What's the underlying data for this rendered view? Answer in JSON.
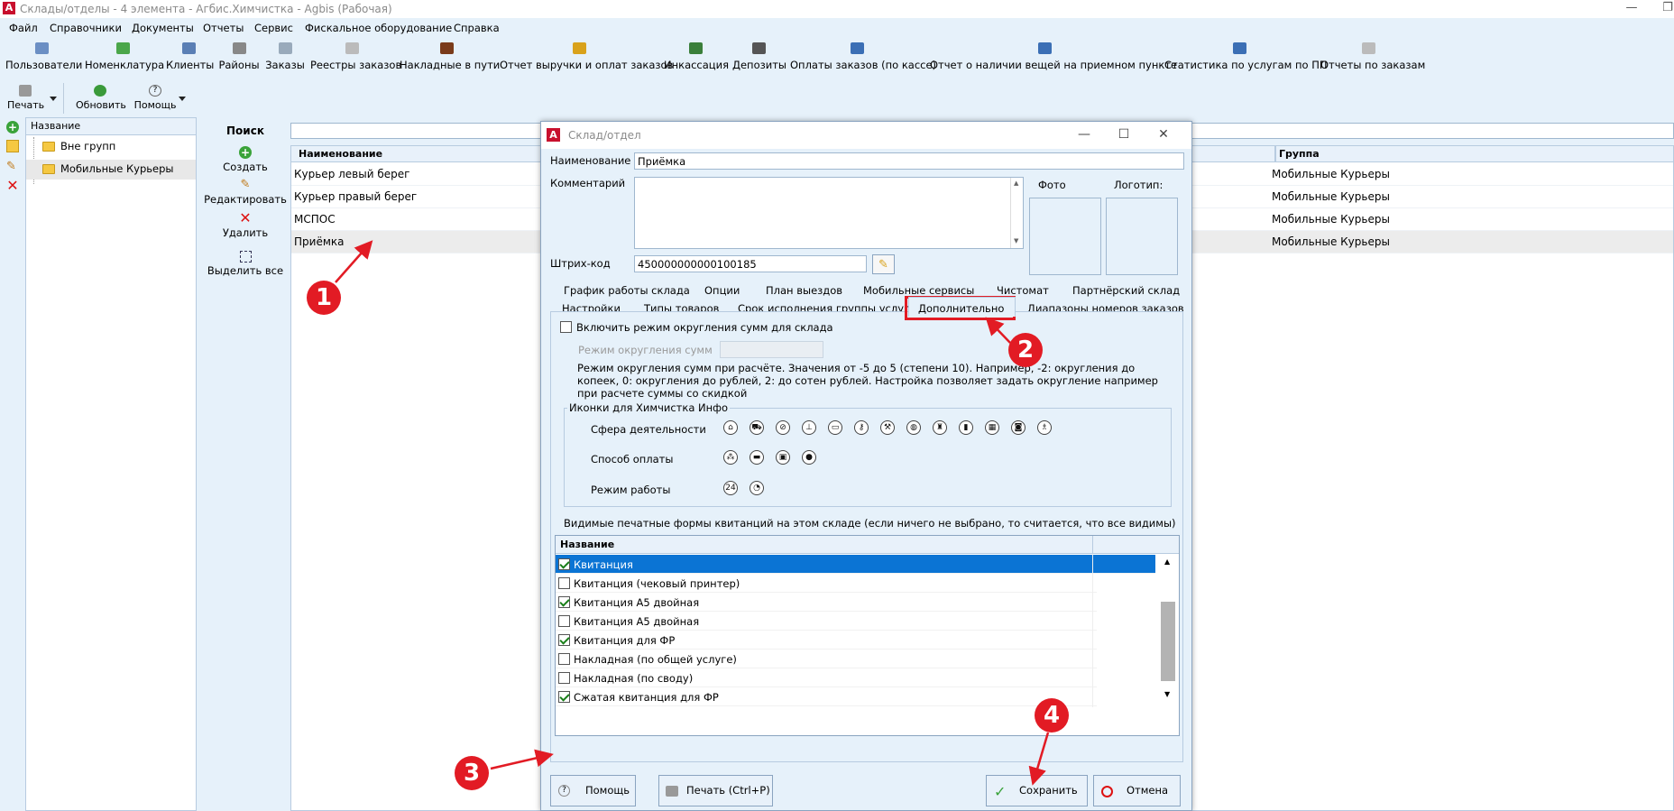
{
  "window": {
    "title": "Склады/отделы - 4 элемента - Агбис.Химчистка - Agbis (Рабочая)",
    "app_logo": "A"
  },
  "menu": [
    "Файл",
    "Справочники",
    "Документы",
    "Отчеты",
    "Сервис",
    "Фискальное оборудование",
    "Справка"
  ],
  "toolbar": [
    {
      "label": "Пользователи",
      "icon": "users-icon"
    },
    {
      "label": "Номенклатура",
      "icon": "nomenclature-icon"
    },
    {
      "label": "Клиенты",
      "icon": "clients-icon"
    },
    {
      "label": "Районы",
      "icon": "districts-icon"
    },
    {
      "label": "Заказы",
      "icon": "orders-icon"
    },
    {
      "label": "Реестры заказов",
      "icon": "registry-icon"
    },
    {
      "label": "Накладные в пути",
      "icon": "truck-icon"
    },
    {
      "label": "Отчет выручки и оплат заказов",
      "icon": "report-icon"
    },
    {
      "label": "Инкассация",
      "icon": "cash-icon"
    },
    {
      "label": "Депозиты",
      "icon": "deposit-icon"
    },
    {
      "label": "Оплаты заказов (по кассе)",
      "icon": "payment-icon"
    },
    {
      "label": "Отчет о наличии вещей на приемном пункте",
      "icon": "items-report-icon"
    },
    {
      "label": "Статистика по услугам по ПП",
      "icon": "stats-icon"
    },
    {
      "label": "Отчеты по заказам",
      "icon": "orders-report-icon"
    }
  ],
  "toolbar2": {
    "print": "Печать",
    "refresh": "Обновить",
    "help": "Помощь"
  },
  "tree": {
    "header": "Название",
    "items": [
      "Вне групп",
      "Мобильные Курьеры"
    ]
  },
  "actions": {
    "search": "Поиск",
    "create": "Создать",
    "edit": "Редактировать",
    "delete": "Удалить",
    "select_all": "Выделить все"
  },
  "grid": {
    "col_name": "Наименование",
    "col_group": "Группа",
    "rows": [
      {
        "name": "Курьер левый берег",
        "group": "Мобильные Курьеры"
      },
      {
        "name": "Курьер правый берег",
        "group": "Мобильные Курьеры"
      },
      {
        "name": "МСПОС",
        "group": "Мобильные Курьеры"
      },
      {
        "name": "Приёмка",
        "group": "Мобильные Курьеры"
      }
    ]
  },
  "dialog": {
    "title": "Склад/отдел",
    "name_label": "Наименование",
    "name_value": "Приёмка",
    "comment_label": "Комментарий",
    "barcode_label": "Штрих-код",
    "barcode_value": "450000000000100185",
    "photo_label": "Фото",
    "logo_label": "Логотип:",
    "tabs_row1": [
      "График работы склада",
      "Опции",
      "План выездов",
      "Мобильные сервисы",
      "Чистомат",
      "Партнёрский склад"
    ],
    "tabs_row2": [
      "Настройки",
      "Типы товаров",
      "Срок исполнения группы услуг",
      "Дополнительно",
      "Диапазоны номеров заказов"
    ],
    "active_tab": "Дополнительно",
    "rounding_checkbox": "Включить режим округления сумм для склада",
    "rounding_checked": false,
    "rounding_mode_label": "Режим округления сумм",
    "rounding_mode_value": "",
    "rounding_help": "Режим округления сумм при расчёте. Значения от -5 до 5 (степени 10). Например, -2: округления до копеек, 0: округления до рублей, 2: до сотен рублей. Настройка позволяет задать округление например при расчете суммы со скидкой",
    "icons_group_title": "Иконки для Химчистка Инфо",
    "icons_rows": [
      {
        "label": "Сфера деятельности",
        "icons": [
          "cleaning-icon",
          "car-icon",
          "hanger-icon",
          "iron-icon",
          "bag-icon",
          "key-icon",
          "tool-icon",
          "bucket-icon",
          "shirt-icon",
          "shoe-icon",
          "grid-icon",
          "washer-icon",
          "bottles-icon"
        ]
      },
      {
        "label": "Способ оплаты",
        "icons": [
          "coins-icon",
          "card-icon",
          "gift-icon",
          "money-bag-icon"
        ]
      },
      {
        "label": "Режим работы",
        "icons": [
          "clock-24-icon",
          "clock-icon"
        ]
      }
    ],
    "forms_caption": "Видимые печатные формы квитанций на этом складе (если ничего не выбрано, то считается, что все видимы)",
    "forms_header": "Название",
    "forms": [
      {
        "label": "Квитанция",
        "checked": true,
        "selected": true
      },
      {
        "label": "Квитанция (чековый принтер)",
        "checked": false,
        "selected": false
      },
      {
        "label": "Квитанция А5 двойная",
        "checked": true,
        "selected": false
      },
      {
        "label": "Квитанция А5 двойная",
        "checked": false,
        "selected": false
      },
      {
        "label": "Квитанция для ФР",
        "checked": true,
        "selected": false
      },
      {
        "label": "Накладная (по общей услуге)",
        "checked": false,
        "selected": false
      },
      {
        "label": "Накладная (по своду)",
        "checked": false,
        "selected": false
      },
      {
        "label": "Сжатая квитанция для ФР",
        "checked": true,
        "selected": false
      }
    ],
    "btn_help": "Помощь",
    "btn_print": "Печать (Ctrl+P)",
    "btn_save": "Сохранить",
    "btn_cancel": "Отмена"
  },
  "annotations": [
    "1",
    "2",
    "3",
    "4"
  ],
  "colors": {
    "accent_red": "#e21b24",
    "selection_blue": "#0b74d4",
    "panel_bg": "#e6f1fa"
  }
}
